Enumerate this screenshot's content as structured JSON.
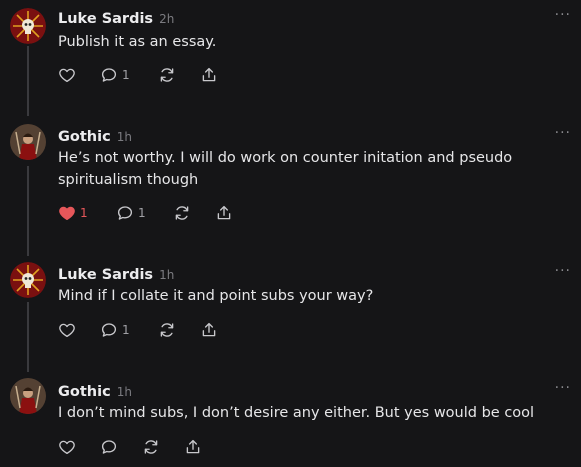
{
  "comments": [
    {
      "author": "Luke Sardis",
      "time": "2h",
      "avatar": "skull-sun-avatar",
      "text": "Publish it as an essay.",
      "liked": false,
      "like_count": "",
      "reply_count": "1"
    },
    {
      "author": "Gothic",
      "time": "1h",
      "avatar": "gothic-figure-avatar",
      "text": "He’s not worthy. I will do work on counter initation and pseudo spiritualism though",
      "liked": true,
      "like_count": "1",
      "reply_count": "1"
    },
    {
      "author": "Luke Sardis",
      "time": "1h",
      "avatar": "skull-sun-avatar",
      "text": "Mind if I collate it and point subs your way?",
      "liked": false,
      "like_count": "",
      "reply_count": "1"
    },
    {
      "author": "Gothic",
      "time": "1h",
      "avatar": "gothic-figure-avatar",
      "text": "I don’t mind subs, I don’t desire any either. But yes would be cool",
      "liked": false,
      "like_count": "",
      "reply_count": ""
    }
  ],
  "more_glyph": "···",
  "colors": {
    "background": "#151517",
    "liked": "#e6575a",
    "muted": "#8a8a8e"
  }
}
